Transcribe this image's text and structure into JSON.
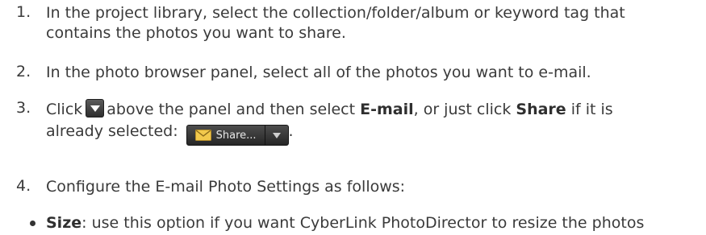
{
  "steps": [
    {
      "number": "1.",
      "line1": "In the project library, select the collection/folder/album or keyword tag that",
      "line2": "contains the photos you want to share."
    },
    {
      "number": "2.",
      "line1": "In the photo browser panel, select all of the photos you want to e-mail."
    },
    {
      "number": "3.",
      "t1": "Click",
      "t2": "above the panel and then select",
      "b1": "E-mail",
      "t3": ", or just click",
      "b2": "Share",
      "t4": "if it is",
      "t5": "already selected:",
      "t6": ".",
      "share_button_label": "Share..."
    },
    {
      "number": "4.",
      "line1": "Configure the E-mail Photo Settings as follows:"
    }
  ],
  "bullet": {
    "label": "Size",
    "text": ": use this option if you want CyberLink PhotoDirector to resize the photos"
  },
  "icons": {
    "dropdown": "dropdown-arrow-icon",
    "share": "envelope-icon",
    "share_menu": "chevron-down-icon"
  },
  "colors": {
    "text": "#3a3a3a",
    "button_bg": "#3a3a3a",
    "envelope": "#f2c94c"
  }
}
